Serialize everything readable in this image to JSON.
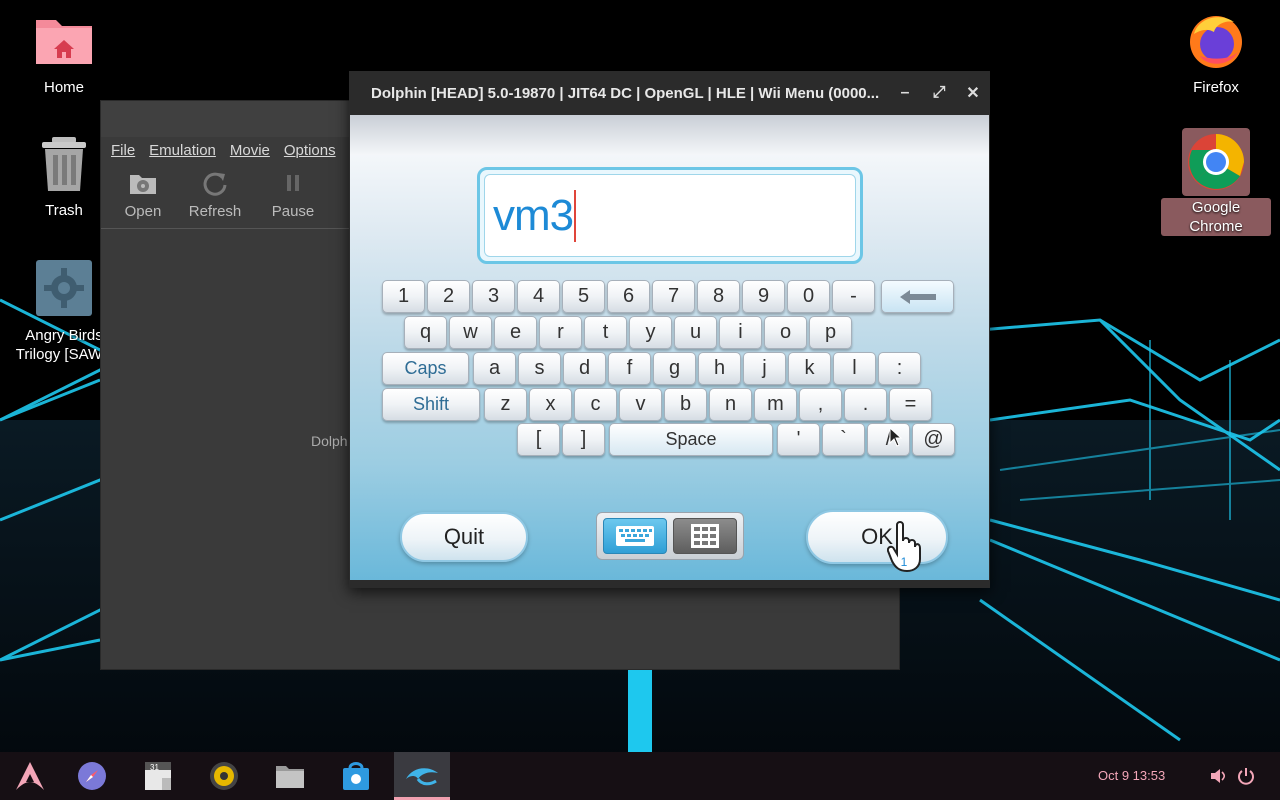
{
  "desktop": {
    "icons": [
      {
        "label": "Home"
      },
      {
        "label": "Trash"
      },
      {
        "label": "Angry Birds Trilogy [SAWE"
      },
      {
        "label": "Firefox"
      },
      {
        "label": "Google Chrome"
      }
    ]
  },
  "dolphin_main": {
    "menu": [
      "File",
      "Emulation",
      "Movie",
      "Options"
    ],
    "toolbar": [
      "Open",
      "Refresh",
      "Pause"
    ],
    "hint_text": "Dolph"
  },
  "render_window": {
    "title": "Dolphin [HEAD] 5.0-19870 | JIT64 DC | OpenGL | HLE | Wii Menu (0000...",
    "controls": {
      "minimize": "–",
      "maximize": "⤢",
      "close": "✕"
    }
  },
  "wii_keyboard": {
    "input_value": "vm3",
    "rows": [
      [
        "1",
        "2",
        "3",
        "4",
        "5",
        "6",
        "7",
        "8",
        "9",
        "0",
        "-"
      ],
      [
        "q",
        "w",
        "e",
        "r",
        "t",
        "y",
        "u",
        "i",
        "o",
        "p"
      ],
      [
        "a",
        "s",
        "d",
        "f",
        "g",
        "h",
        "j",
        "k",
        "l",
        ":"
      ],
      [
        "z",
        "x",
        "c",
        "v",
        "b",
        "n",
        "m",
        ",",
        ".",
        "="
      ],
      [
        "[",
        "]",
        "'",
        "`",
        "/",
        "@"
      ]
    ],
    "caps_label": "Caps",
    "shift_label": "Shift",
    "space_label": "Space",
    "backspace_icon": "left-arrow-icon",
    "quit_label": "Quit",
    "ok_label": "OK",
    "modes": [
      "keyboard-icon",
      "keypad-grid-icon"
    ]
  },
  "taskbar": {
    "apps": [
      "arch-icon",
      "compass-icon",
      "calendar-icon",
      "music-icon",
      "files-icon",
      "store-icon",
      "dolphin-icon"
    ],
    "clock": "Oct 9  13:53",
    "colors": {
      "accent": "#f3a6b8"
    }
  }
}
